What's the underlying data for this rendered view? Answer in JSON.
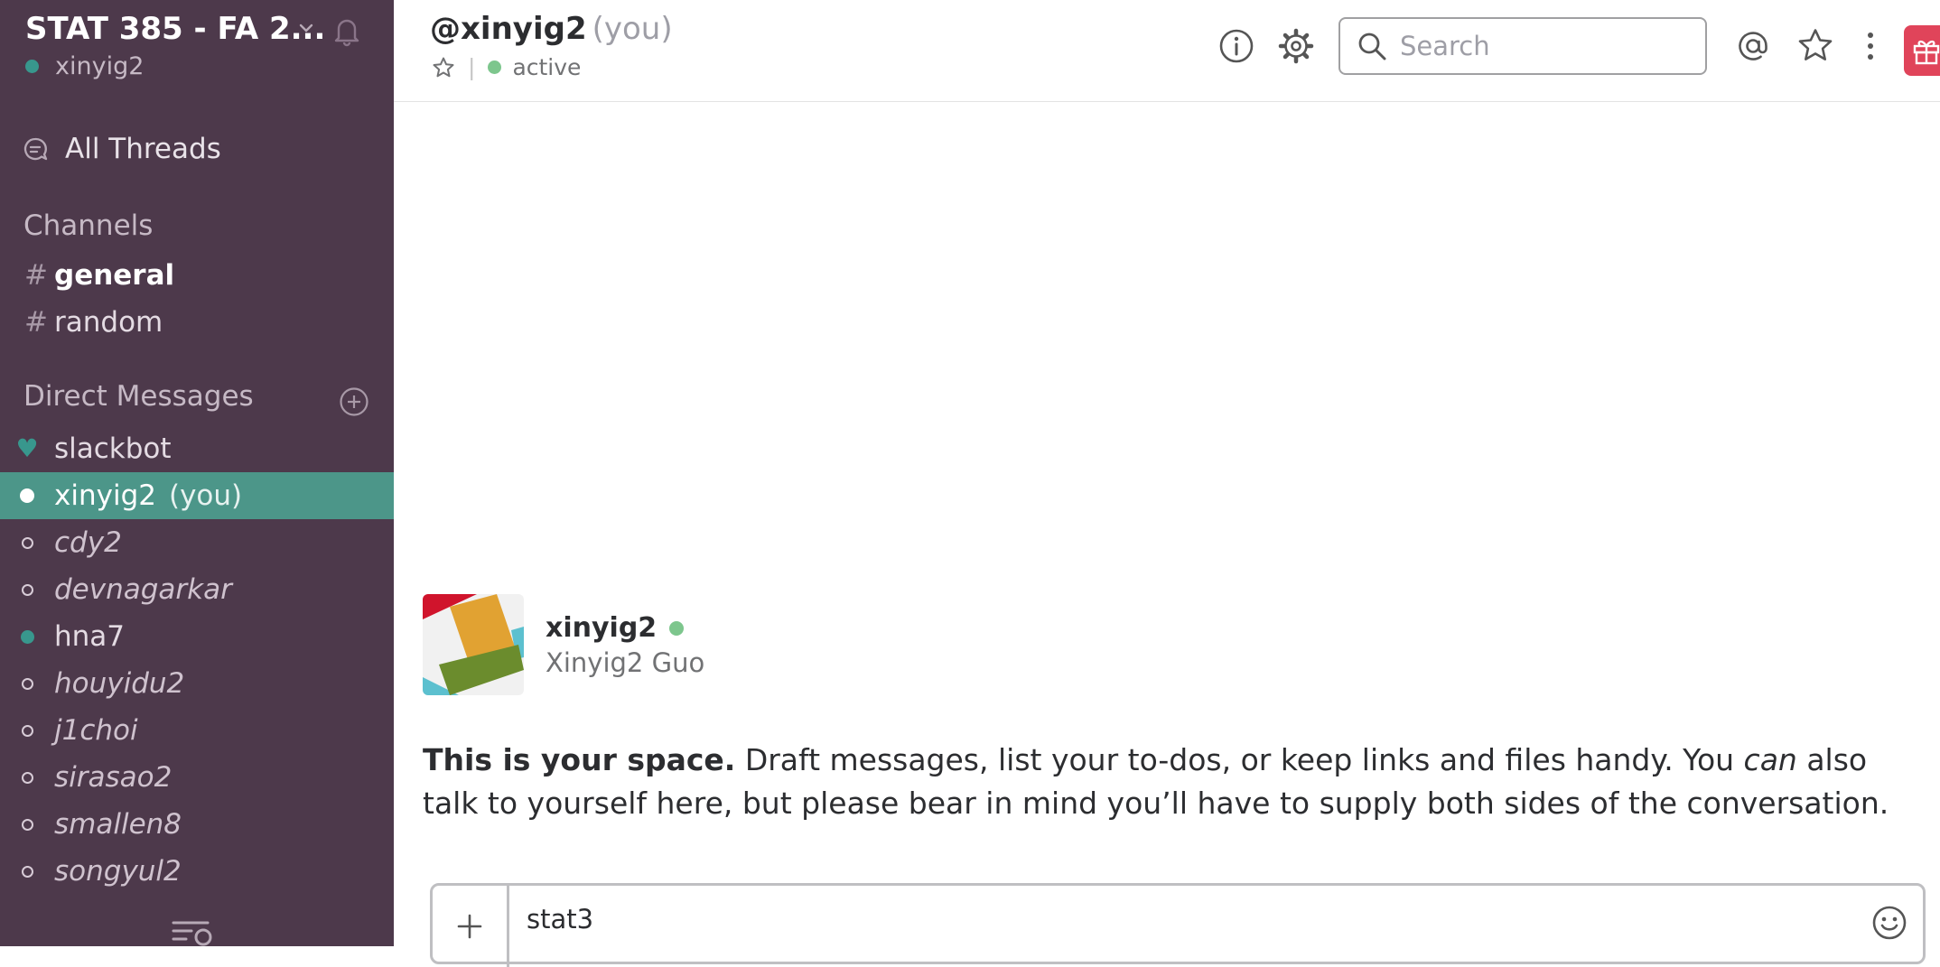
{
  "sidebar": {
    "team_name": "STAT 385 - FA 2...",
    "username": "xinyig2",
    "all_threads": "All Threads",
    "channels_label": "Channels",
    "channels": [
      {
        "hash": "#",
        "name": "general"
      },
      {
        "hash": "#",
        "name": "random"
      }
    ],
    "dm_label": "Direct Messages",
    "dms": [
      {
        "name": "slackbot"
      },
      {
        "name": "xinyig2",
        "suffix": "(you)"
      },
      {
        "name": "cdy2"
      },
      {
        "name": "devnagarkar"
      },
      {
        "name": "hna7"
      },
      {
        "name": "houyidu2"
      },
      {
        "name": "j1choi"
      },
      {
        "name": "sirasao2"
      },
      {
        "name": "smallen8"
      },
      {
        "name": "songyul2"
      }
    ]
  },
  "header": {
    "title": "@xinyig2",
    "title_suffix": "(you)",
    "separator": "|",
    "status": "active",
    "search_placeholder": "Search"
  },
  "profile": {
    "username": "xinyig2",
    "real_name": "Xinyig2 Guo"
  },
  "intro": {
    "lead": "This is your space.",
    "text1": " Draft messages, list your to-dos, or keep links and files handy. You ",
    "emphasis": "can",
    "text2": " also talk to yourself here, but please bear in mind you’ll have to supply both sides of the conversation."
  },
  "composer": {
    "plus": "+",
    "value": "stat3"
  },
  "colors": {
    "sidebar_bg": "#4d394b",
    "selected_bg": "#4c9689",
    "presence_green": "#38978d",
    "active_green": "#7dc68d",
    "gift_red": "#e0445a"
  }
}
